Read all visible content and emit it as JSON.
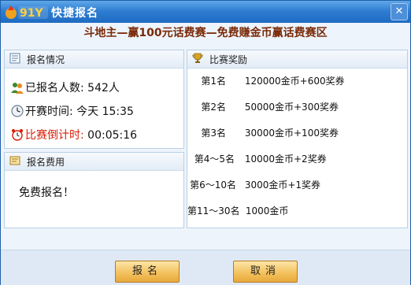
{
  "window": {
    "title": "快捷报名",
    "logo_text": "91Y"
  },
  "headline": "斗地主—赢100元话费赛—免费赚金币赢话费赛区",
  "registration_info": {
    "title": "报名情况",
    "count_label": "已报名人数:",
    "count_value": "542人",
    "start_label": "开赛时间:",
    "start_value": "今天 15:35",
    "countdown_label": "比赛倒计时:",
    "countdown_value": "00:05:16"
  },
  "fee": {
    "title": "报名费用",
    "text": "免费报名！"
  },
  "prizes": {
    "title": "比赛奖励",
    "items": [
      {
        "rank": "第1名",
        "reward": "120000金币+600奖券"
      },
      {
        "rank": "第2名",
        "reward": "50000金币+300奖券"
      },
      {
        "rank": "第3名",
        "reward": "30000金币+100奖券"
      },
      {
        "rank": "第4～5名",
        "reward": "10000金币+2奖券"
      },
      {
        "rank": "第6～10名",
        "reward": "3000金币+1奖券"
      },
      {
        "rank": "第11～30名",
        "reward": "1000金币"
      }
    ]
  },
  "buttons": {
    "register": "报名",
    "cancel": "取消"
  },
  "icons": [
    "logo-icon",
    "close-icon",
    "document-icon",
    "users-icon",
    "clock-icon",
    "alarm-clock-icon",
    "fee-icon",
    "trophy-icon"
  ],
  "colors": {
    "titlebar": "#2f7ed3",
    "headline": "#7a2a08",
    "countdown": "#d81e06",
    "button": "#f3c260"
  }
}
